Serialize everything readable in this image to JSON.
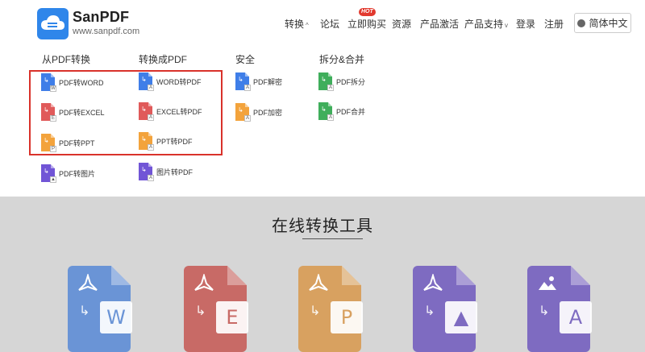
{
  "header": {
    "brand": "SanPDF",
    "url": "www.sanpdf.com",
    "nav": [
      {
        "label": "转换",
        "caret": "^"
      },
      {
        "label": "论坛"
      },
      {
        "label": "立即购买",
        "badge": "HOT"
      },
      {
        "label": "资源"
      },
      {
        "label": "产品激活"
      },
      {
        "label": "产品支持",
        "caret": "v"
      },
      {
        "label": "登录"
      },
      {
        "label": "注册"
      }
    ],
    "language": "简体中文"
  },
  "menu": {
    "columns": [
      {
        "title": "从PDF转换",
        "items": [
          {
            "label": "PDF转WORD",
            "color": "#3f7ee8",
            "mini": "W"
          },
          {
            "label": "PDF转EXCEL",
            "color": "#e05a5a",
            "mini": "E"
          },
          {
            "label": "PDF转PPT",
            "color": "#f3a33c",
            "mini": "P"
          },
          {
            "label": "PDF转图片",
            "color": "#7155d6",
            "mini": "▲"
          }
        ]
      },
      {
        "title": "转换成PDF",
        "items": [
          {
            "label": "WORD转PDF",
            "color": "#3f7ee8",
            "mini": "A"
          },
          {
            "label": "EXCEL转PDF",
            "color": "#e05a5a",
            "mini": "A"
          },
          {
            "label": "PPT转PDF",
            "color": "#f3a33c",
            "mini": "A"
          },
          {
            "label": "图片转PDF",
            "color": "#7155d6",
            "mini": "A"
          }
        ]
      },
      {
        "title": "安全",
        "items": [
          {
            "label": "PDF解密",
            "color": "#3f7ee8",
            "mini": "A"
          },
          {
            "label": "PDF加密",
            "color": "#f3a33c",
            "mini": "A"
          }
        ]
      },
      {
        "title": "拆分&合并",
        "items": [
          {
            "label": "PDF拆分",
            "color": "#3fae5b",
            "mini": "A"
          },
          {
            "label": "PDF合并",
            "color": "#3fae5b",
            "mini": "A"
          }
        ]
      }
    ]
  },
  "tools_section": {
    "title": "在线转换工具",
    "tools": [
      {
        "icon": "pdf-to-word-icon",
        "letter": "W",
        "color": "#3f7ee8"
      },
      {
        "icon": "pdf-to-excel-icon",
        "letter": "E",
        "color": "#e05a5a"
      },
      {
        "icon": "pdf-to-ppt-icon",
        "letter": "P",
        "color": "#f3a33c"
      },
      {
        "icon": "pdf-to-image-icon",
        "letter": "▲",
        "color": "#7155d6"
      },
      {
        "icon": "image-to-pdf-icon",
        "letter": "A",
        "color": "#7155d6"
      }
    ]
  }
}
